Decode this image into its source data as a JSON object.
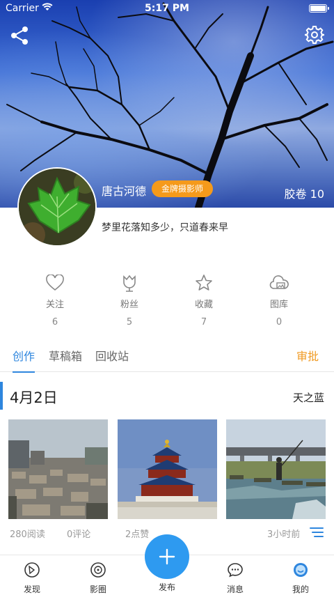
{
  "status_bar": {
    "carrier": "Carrier",
    "time": "5:17 PM"
  },
  "profile": {
    "username": "唐古河德",
    "badge": "金牌摄影师",
    "film_label": "胶卷 10",
    "motto": "梦里花落知多少，只道春来早"
  },
  "stats": [
    {
      "icon": "heart-icon",
      "label": "关注",
      "value": "6"
    },
    {
      "icon": "tulip-icon",
      "label": "粉丝",
      "value": "5"
    },
    {
      "icon": "star-icon",
      "label": "收藏",
      "value": "7"
    },
    {
      "icon": "cloud-gallery-icon",
      "label": "图库",
      "value": "0"
    }
  ],
  "tabs": [
    {
      "label": "创作",
      "active": true
    },
    {
      "label": "草稿箱",
      "active": false
    },
    {
      "label": "回收站",
      "active": false
    }
  ],
  "approve_label": "审批",
  "post": {
    "date": "4月2日",
    "author": "天之蓝",
    "reads": "280阅读",
    "comments": "0评论",
    "likes": "2点赞",
    "time_ago": "3小时前"
  },
  "nav": {
    "discover": "发现",
    "circle": "影圈",
    "publish": "发布",
    "messages": "消息",
    "mine": "我的"
  },
  "colors": {
    "accent": "#2e86de",
    "badge": "#f59a1b",
    "approve": "#f09a22",
    "publish": "#2e9af0"
  }
}
